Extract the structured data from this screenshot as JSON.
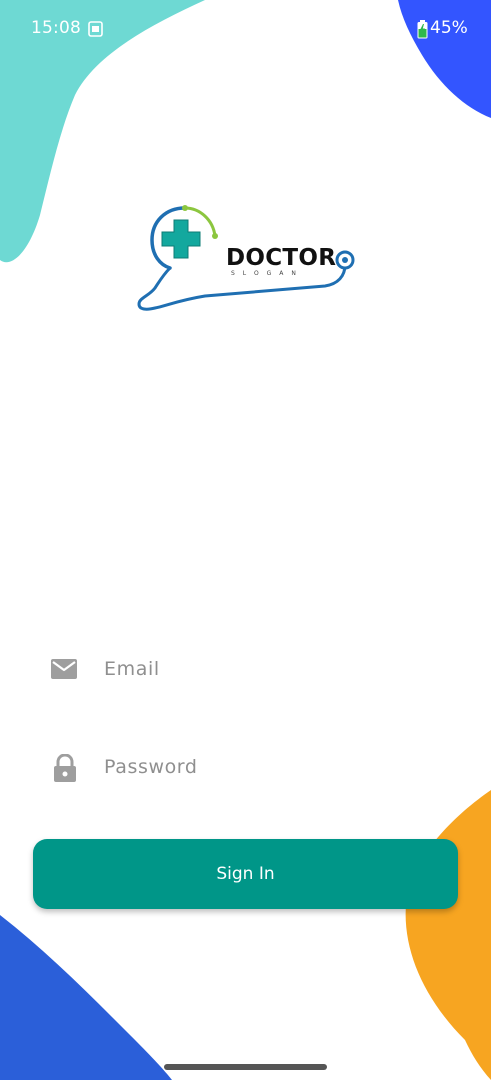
{
  "status_bar": {
    "time": "15:08",
    "battery_percent": "45%",
    "sim_icon": "sim-card-icon",
    "battery_icon": "battery-charging-icon"
  },
  "logo": {
    "title": "DOCTOR",
    "subtitle": "SLOGAN",
    "icon": "medical-cross-stethoscope-icon"
  },
  "form": {
    "email": {
      "placeholder": "Email",
      "value": "",
      "icon": "mail-icon"
    },
    "password": {
      "placeholder": "Password",
      "value": "",
      "icon": "lock-icon"
    },
    "sign_in_label": "Sign In"
  },
  "colors": {
    "accent": "#009688",
    "top_left_blob": "#6ed9d3",
    "top_right_blob": "#3355ff",
    "bottom_left_blob": "#2b5fd9",
    "bottom_right_blob": "#f7a521",
    "logo_blue": "#1f6fb2",
    "logo_teal": "#13a89e",
    "logo_green": "#8cc63f"
  }
}
